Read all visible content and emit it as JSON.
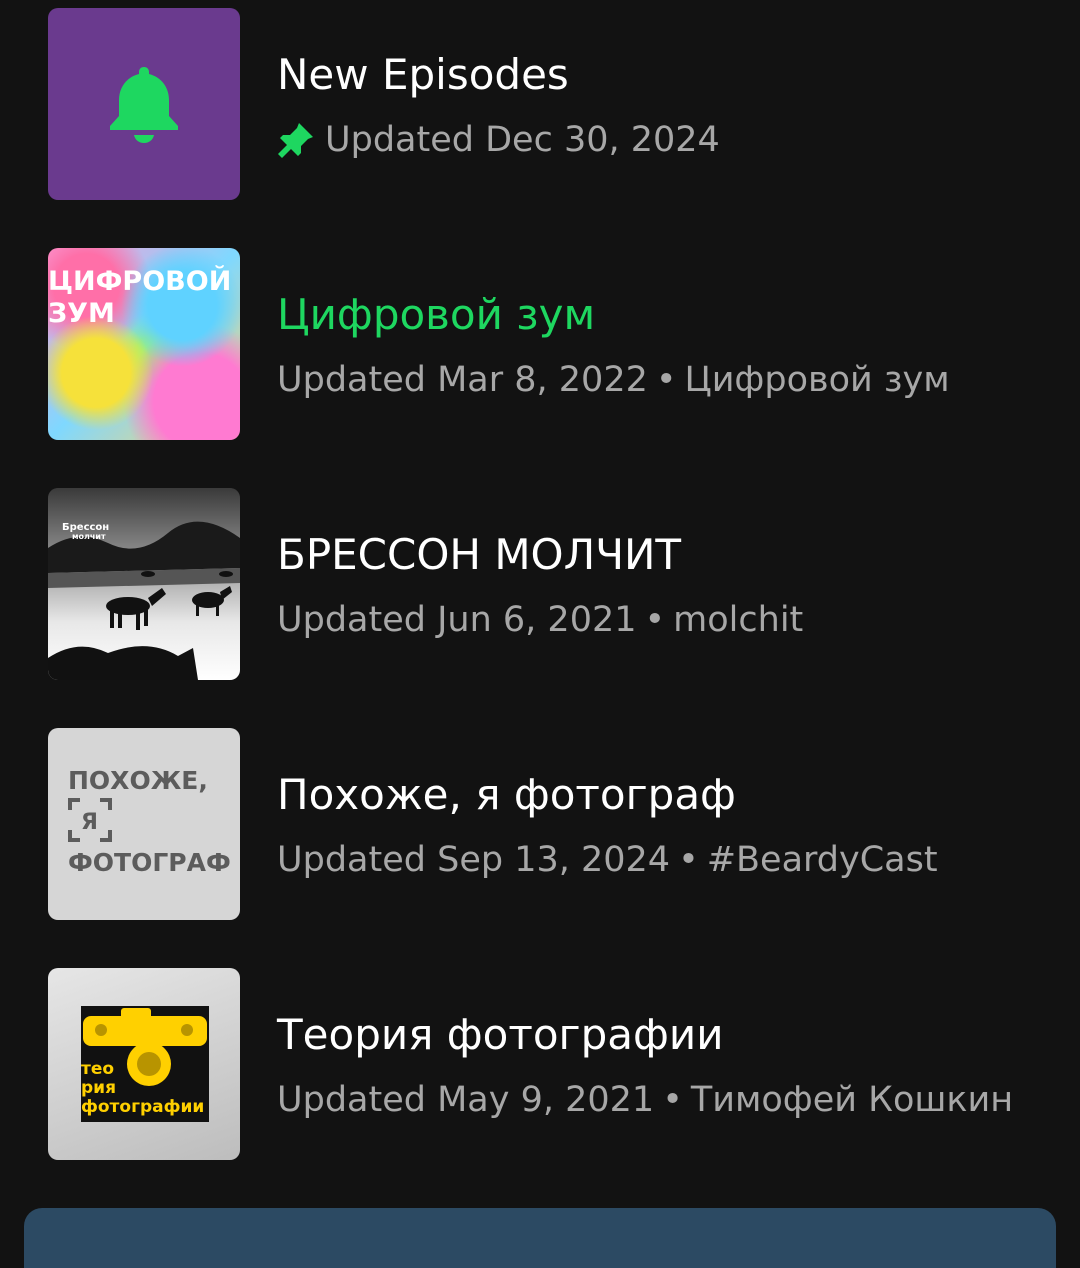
{
  "colors": {
    "background": "#121212",
    "accent": "#1ed760",
    "secondary_text": "#a7a7a7",
    "new_episodes_cover": "#6a3a8e",
    "bottom_bar": "#2c4a63"
  },
  "items": [
    {
      "title": "New Episodes",
      "subtitle": "Updated Dec 30, 2024",
      "pinned": true,
      "icon": "bell-icon",
      "active": false
    },
    {
      "title": "Цифровой зум",
      "updated": "Updated Mar 8, 2022",
      "owner": "Цифровой зум",
      "cover_text": [
        "ЦИФРОВОЙ",
        "ЗУМ"
      ],
      "active": true
    },
    {
      "title": "БРЕССОН МОЛЧИТ",
      "updated": "Updated Jun 6, 2021",
      "owner": "molchit",
      "cover_text": [
        "Брессон",
        "молчит"
      ],
      "active": false
    },
    {
      "title": "Похоже, я фотограф",
      "updated": "Updated Sep 13, 2024",
      "owner": "#BeardyCast",
      "cover_text": [
        "ПОХОЖЕ,",
        "Я",
        "ФОТОГРАФ"
      ],
      "active": false
    },
    {
      "title": "Теория фотографии",
      "updated": "Updated May 9, 2021",
      "owner": "Тимофей Кошкин",
      "cover_text": [
        "тео",
        "рия",
        "фотографии"
      ],
      "active": false
    }
  ],
  "separator": "•"
}
